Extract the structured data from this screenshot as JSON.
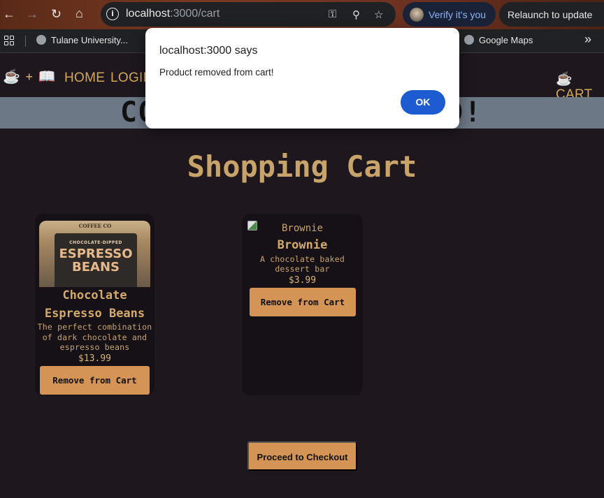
{
  "browser": {
    "url_host": "localhost",
    "url_path": ":3000/cart",
    "verify_label": "Verify it's you",
    "relaunch_label": "Relaunch to update",
    "bookmarks": [
      "Tulane University...",
      "Google Maps"
    ],
    "more_bookmarks": "»"
  },
  "site": {
    "logo_separator": "+",
    "nav": {
      "home": "HOME",
      "login": "LOGIN",
      "cart": "CART"
    },
    "banner_left": "CO",
    "banner_right": "D!"
  },
  "page": {
    "title": "Shopping Cart"
  },
  "cart_items": [
    {
      "image_label_small": "CHOCOLATE-DIPPED",
      "image_label_big": "ESPRESSO BEANS",
      "image_brand": "COFFEE CO",
      "name_line1": "Chocolate",
      "name_line2": "Espresso Beans",
      "desc_line1": "The perfect combination",
      "desc_line2": "of dark chocolate and",
      "desc_line3": "espresso beans",
      "price": "$13.99",
      "button": "Remove from Cart"
    },
    {
      "image_alt": "Brownie",
      "name_line1": "Brownie",
      "desc_line1": "A chocolate baked",
      "desc_line2": "dessert bar",
      "price": "$3.99",
      "button": "Remove from Cart"
    }
  ],
  "checkout_label": "Proceed to Checkout",
  "dialog": {
    "title": "localhost:3000 says",
    "message": "Product removed from cart!",
    "ok_label": "OK"
  },
  "colors": {
    "page_bg": "#1e181e",
    "accent": "#d49456",
    "title": "#c9a46a",
    "dialog_button": "#1d5bd0"
  }
}
